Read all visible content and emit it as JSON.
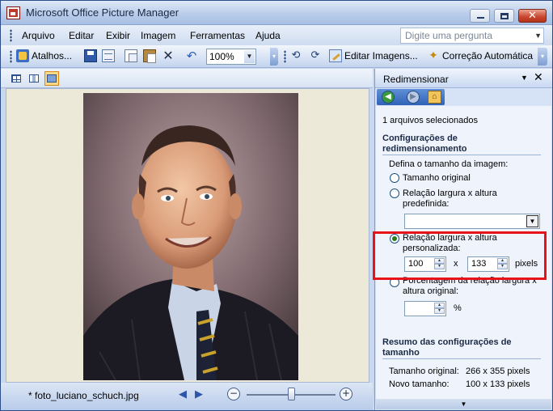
{
  "window": {
    "title": "Microsoft Office Picture Manager",
    "min_glyph": "",
    "max_glyph": "",
    "close_glyph": "✕"
  },
  "menu": {
    "items": [
      "Arquivo",
      "Editar",
      "Exibir",
      "Imagem",
      "Ferramentas",
      "Ajuda"
    ],
    "help_placeholder": "Digite uma pergunta"
  },
  "toolbar": {
    "shortcuts_label": "Atalhos...",
    "zoom_value": "100%",
    "edit_images_label": "Editar Imagens...",
    "auto_correct_label": "Correção Automática"
  },
  "status": {
    "filename": "* foto_luciano_schuch.jpg",
    "prev_glyph": "◀",
    "next_glyph": "▶",
    "zoom_out_glyph": "−",
    "zoom_in_glyph": "+",
    "zoom_slider_level": 0.5
  },
  "pane": {
    "title": "Redimensionar",
    "dropdown_glyph": "▼",
    "close_glyph": "✕",
    "selected_count": "1 arquivos selecionados",
    "settings_heading_line1": "Configurações de",
    "settings_heading_line2": "redimensionamento",
    "define_size_label": "Defina o tamanho da imagem:",
    "option_original": "Tamanho original",
    "option_predefined_line1": "Relação largura x altura",
    "option_predefined_line2": "predefinida:",
    "predefined_value": "",
    "option_custom_line1": "Relação largura x altura",
    "option_custom_line2": "personalizada:",
    "custom_width": "100",
    "custom_height": "133",
    "times_label": "x",
    "pixels_label": "pixels",
    "option_percent_line1": "Porcentagem da relação largura x",
    "option_percent_line2": "altura original:",
    "percent_value": "",
    "percent_label": "%",
    "summary_heading_line1": "Resumo das configurações de",
    "summary_heading_line2": "tamanho",
    "original_size_label": "Tamanho original:",
    "original_size_value": "266 x 355 pixels",
    "new_size_label": "Novo tamanho:",
    "new_size_value": "100 x 133 pixels",
    "selected_option": "custom"
  },
  "colors": {
    "highlight_border": "#e8121b",
    "pane_background": "#eef3fc",
    "title_gradient_end": "#a8c0e4"
  }
}
